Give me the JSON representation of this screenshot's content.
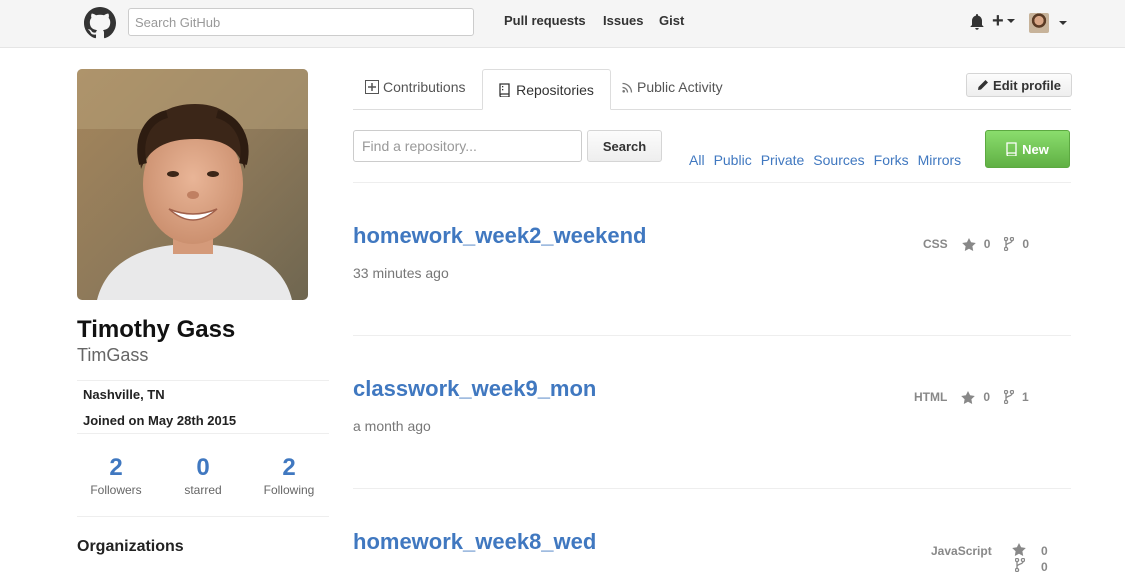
{
  "header": {
    "search_placeholder": "Search GitHub",
    "nav": [
      "Pull requests",
      "Issues",
      "Gist"
    ]
  },
  "profile": {
    "full_name": "Timothy Gass",
    "username": "TimGass",
    "location": "Nashville, TN",
    "joined": "Joined on May 28th 2015",
    "stats": [
      {
        "value": "2",
        "label": "Followers"
      },
      {
        "value": "0",
        "label": "starred"
      },
      {
        "value": "2",
        "label": "Following"
      }
    ],
    "organizations_title": "Organizations"
  },
  "tabs": [
    {
      "label": "Contributions",
      "icon": "plus-box-icon"
    },
    {
      "label": "Repositories",
      "icon": "repo-book-icon",
      "active": true
    },
    {
      "label": "Public Activity",
      "icon": "rss-icon"
    }
  ],
  "edit_profile_label": "Edit profile",
  "filter": {
    "placeholder": "Find a repository...",
    "search_label": "Search",
    "types": [
      "All",
      "Public",
      "Private",
      "Sources",
      "Forks",
      "Mirrors"
    ],
    "new_label": "New"
  },
  "repos": [
    {
      "name": "homework_week2_weekend",
      "updated": "33 minutes ago",
      "language": "CSS",
      "stars": "0",
      "forks": "0"
    },
    {
      "name": "classwork_week9_mon",
      "updated": "a month ago",
      "language": "HTML",
      "stars": "0",
      "forks": "1"
    },
    {
      "name": "homework_week8_wed",
      "updated": "",
      "language": "JavaScript",
      "stars": "0",
      "forks": "0"
    }
  ],
  "colors": {
    "link": "#4078c0",
    "new_button": "#6cc644",
    "header_bg": "#f5f5f5"
  }
}
